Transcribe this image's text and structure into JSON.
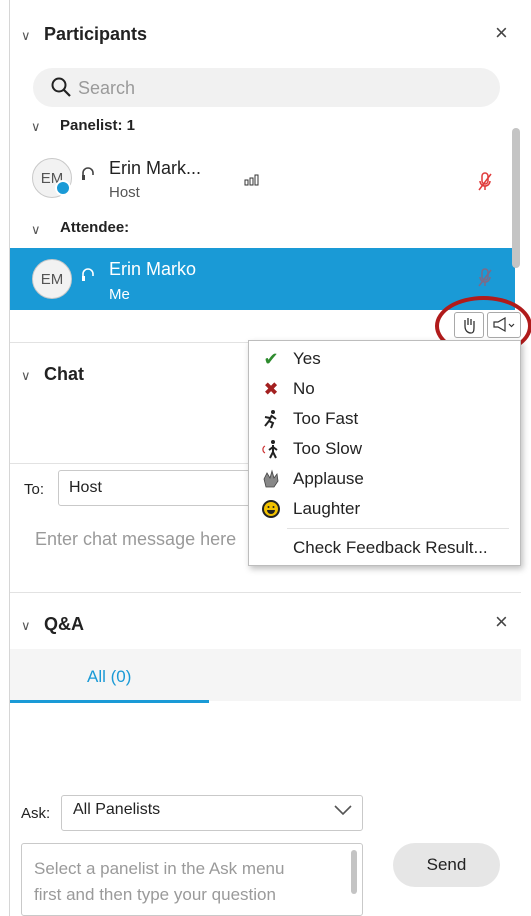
{
  "participants": {
    "title": "Participants",
    "search_placeholder": "Search",
    "panelist_group": "Panelist: 1",
    "attendee_group": "Attendee:",
    "panelist": {
      "initials": "EM",
      "name": "Erin Mark...",
      "role": "Host"
    },
    "attendee": {
      "initials": "EM",
      "name": "Erin Marko",
      "role": "Me"
    }
  },
  "feedback_menu": {
    "items": [
      {
        "icon": "check-icon",
        "label": "Yes",
        "color": "#2e8b2e"
      },
      {
        "icon": "x-icon",
        "label": "No",
        "color": "#a32020"
      },
      {
        "icon": "running-man-icon",
        "label": "Too Fast"
      },
      {
        "icon": "walking-man-icon",
        "label": "Too Slow"
      },
      {
        "icon": "clapping-hand-icon",
        "label": "Applause"
      },
      {
        "icon": "smiley-icon",
        "label": "Laughter"
      }
    ],
    "check_results": "Check Feedback Result..."
  },
  "chat": {
    "title": "Chat",
    "to_label": "To:",
    "to_value": "Host",
    "message_placeholder": "Enter chat message here"
  },
  "qa": {
    "title": "Q&A",
    "tab_all": "All (0)",
    "ask_label": "Ask:",
    "ask_select": "All Panelists",
    "question_placeholder_line1": "Select a panelist in the Ask menu",
    "question_placeholder_line2": "first and then type your question",
    "send_label": "Send"
  },
  "colors": {
    "accent": "#1a9ad6",
    "highlight_oval": "#b01b1b",
    "mic_muted": "#e03b3b"
  }
}
